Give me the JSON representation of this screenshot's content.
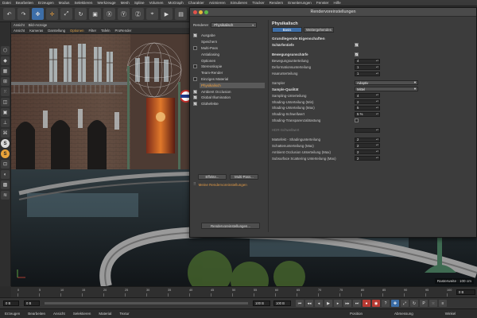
{
  "menubar": [
    "Datei",
    "Bearbeiten",
    "Erzeugen",
    "Modus",
    "Selektieren",
    "Werkzeuge",
    "Mesh",
    "Spline",
    "Volumen",
    "MoGraph",
    "Charakter",
    "Animieren",
    "Simulieren",
    "Tracker",
    "Rendern",
    "Erweiterungen",
    "Fenster",
    "Hilfe"
  ],
  "viewport": {
    "tabs": [
      "Ansicht",
      "Bild-Anzeige"
    ],
    "menu": [
      "Ansicht",
      "Kameras",
      "Darstellung",
      "Optionen",
      "Filter",
      "Tafeln",
      "ProRender"
    ],
    "active_menu": "Optionen",
    "info": "Rasterweite : 100 cm"
  },
  "dialog": {
    "title": "Rendervoreinstellungen",
    "renderer_label": "Renderer",
    "renderer_value": "Physikalisch",
    "list": [
      {
        "label": "Ausgabe",
        "checkbox": "on",
        "selected": false
      },
      {
        "label": "Speichern",
        "checkbox": "off",
        "selected": false
      },
      {
        "label": "Multi-Pass",
        "checkbox": "empty",
        "selected": false
      },
      {
        "label": "Antialiasing",
        "checkbox": "off",
        "selected": false
      },
      {
        "label": "Optionen",
        "checkbox": "off",
        "selected": false
      },
      {
        "label": "Stereoskopie",
        "checkbox": "empty",
        "selected": false
      },
      {
        "label": "Team-Render",
        "checkbox": "off",
        "selected": false
      },
      {
        "label": "Einziges Material",
        "checkbox": "empty",
        "selected": false
      },
      {
        "label": "Physikalisch",
        "checkbox": "off",
        "selected": true
      },
      {
        "label": "Ambient Occlusion",
        "checkbox": "on",
        "selected": false
      },
      {
        "label": "Global Illumination",
        "checkbox": "on",
        "selected": false
      },
      {
        "label": "Glühefekte",
        "checkbox": "on",
        "selected": false
      }
    ],
    "effects_button": "Effekte...",
    "multipass_button": "Multi-Pass...",
    "preset_label": "Meine Rendervoreinstellungen",
    "presets_button": "Rendervoreinstellungen...",
    "section_title": "Physikalisch",
    "tabs": [
      "Basis",
      "Weitergehendes"
    ],
    "active_tab": "Basis",
    "group_title": "Grundlegende Eigenschaften",
    "params": [
      {
        "label": "Schärfentiefe",
        "type": "check",
        "value": true,
        "bold": true
      },
      {
        "label": "",
        "type": "spacer"
      },
      {
        "label": "Bewegungsunschärfe",
        "type": "check",
        "value": true,
        "bold": true
      },
      {
        "label": "Bewegungsunterteilung",
        "type": "number",
        "value": "4"
      },
      {
        "label": "Deformationsunterteilung",
        "type": "number",
        "value": "1"
      },
      {
        "label": "Haarunterteilung",
        "type": "number",
        "value": "1"
      },
      {
        "label": "",
        "type": "spacer"
      },
      {
        "label": "Sampler",
        "type": "select",
        "value": "Adaptiv"
      },
      {
        "label": "Sample-Qualität",
        "type": "select",
        "value": "Mittel",
        "bold": true
      },
      {
        "label": "Sampling-Unterteilung",
        "type": "number",
        "value": "4"
      },
      {
        "label": "Shading-Unterteilung (Min)",
        "type": "number",
        "value": "2"
      },
      {
        "label": "Shading-Unterteilung (Max)",
        "type": "number",
        "value": "5"
      },
      {
        "label": "Shading-Schwellwert",
        "type": "number",
        "value": "5 %"
      },
      {
        "label": "Shading-Transparenzabtastung",
        "type": "check",
        "value": false
      },
      {
        "label": "",
        "type": "spacer"
      },
      {
        "label": "HDR-Schwellwert",
        "type": "number",
        "value": "",
        "dim": true
      },
      {
        "label": "",
        "type": "spacer"
      },
      {
        "label": "Mattefekt - Shadingunterteilung",
        "type": "number",
        "value": "2"
      },
      {
        "label": "Schattenunterteilung (Max)",
        "type": "number",
        "value": "2"
      },
      {
        "label": "Ambient Occlusion Unterteilung (Max)",
        "type": "number",
        "value": "2"
      },
      {
        "label": "Subsurface Scattering Unterteilung (Max)",
        "type": "number",
        "value": "2"
      }
    ]
  },
  "timeline": {
    "ticks": [
      "0",
      "5",
      "10",
      "15",
      "20",
      "25",
      "30",
      "35",
      "40",
      "45",
      "50",
      "55",
      "60",
      "65",
      "70",
      "75",
      "80",
      "85",
      "90",
      "95",
      "100"
    ],
    "frame_field": "0 B"
  },
  "transport": {
    "start": "0 B",
    "start2": "0 B",
    "end": "100 B",
    "end2": "100 B"
  },
  "statusbar": {
    "items": [
      "Erzeugen",
      "Bearbeiten",
      "Ansicht",
      "Selektieren",
      "Material",
      "Textur"
    ],
    "right_items": [
      "Position",
      "Abmessung",
      "Winkel"
    ]
  },
  "colors": {
    "accent_orange": "#e59a3b",
    "selection_blue": "#3e6fa8",
    "record_red": "#b83a33"
  }
}
